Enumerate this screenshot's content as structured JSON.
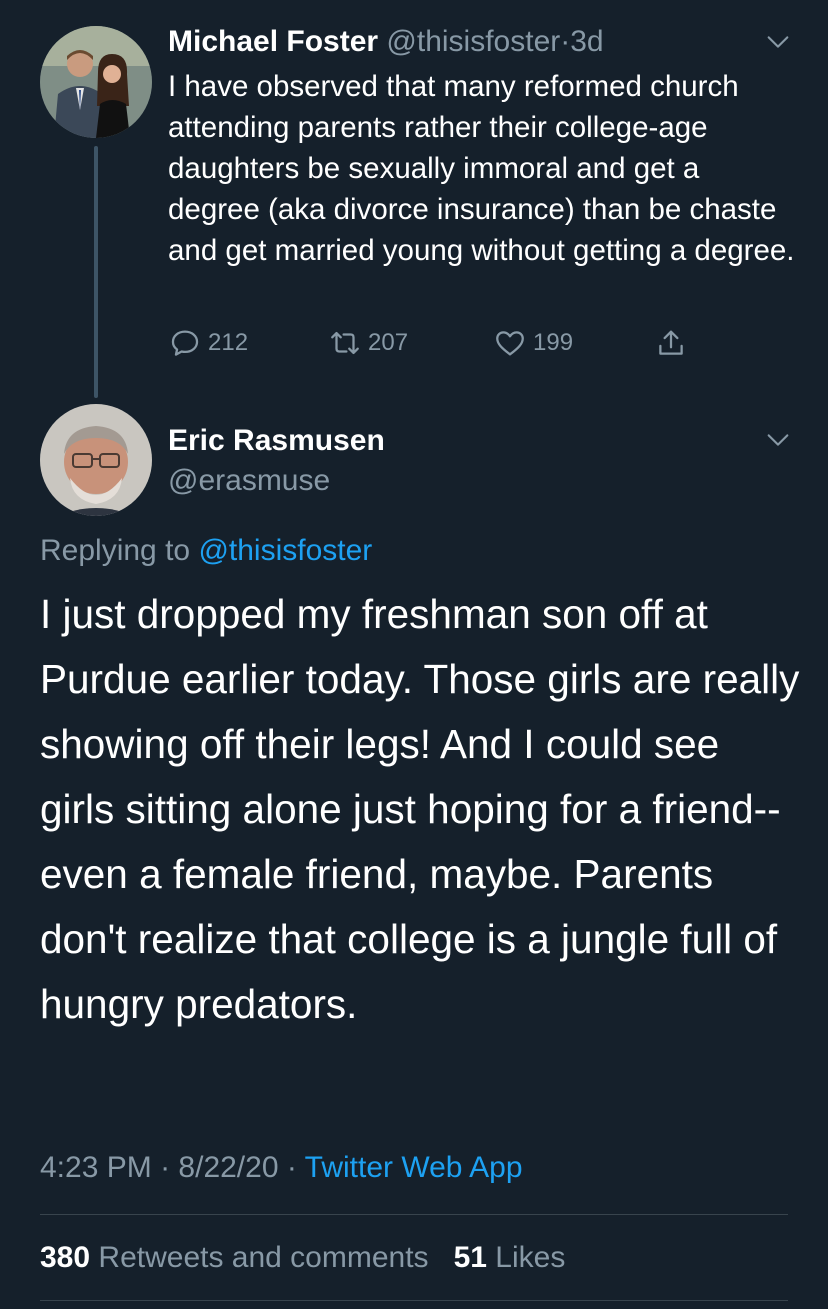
{
  "parent_tweet": {
    "author_name": "Michael Foster",
    "handle": "@thisisfoster",
    "separator": "·",
    "age": "3d",
    "text": "I have observed that many reformed church attending parents rather their college-age daughters be sexually immoral and get a degree (aka divorce insurance) than be chaste and get married young without getting a degree.",
    "replies": "212",
    "retweets": "207",
    "likes": "199"
  },
  "main_tweet": {
    "author_name": "Eric Rasmusen",
    "handle": "@erasmuse",
    "replying_prefix": "Replying to",
    "replying_to": "@thisisfoster",
    "text": "I just dropped my freshman son off at Purdue earlier today. Those girls are really showing off their legs! And I could see girls sitting alone just hoping for a friend-- even a female friend, maybe. Parents don't realize that college is a jungle full of hungry predators.",
    "time": "4:23 PM",
    "sep1": "·",
    "date": "8/22/20",
    "sep2": "·",
    "source": "Twitter Web App",
    "retweets_count": "380",
    "retweets_label": "Retweets and comments",
    "likes_count": "51",
    "likes_label": "Likes"
  },
  "icons": {
    "reply": "speech-bubble-icon",
    "retweet": "retweet-arrows-icon",
    "like": "heart-icon",
    "share": "share-upload-icon",
    "menu": "chevron-down-icon"
  },
  "colors": {
    "background": "#15202b",
    "text": "#ffffff",
    "muted": "#8899a6",
    "link": "#1da1f2",
    "divider": "#38444d"
  }
}
